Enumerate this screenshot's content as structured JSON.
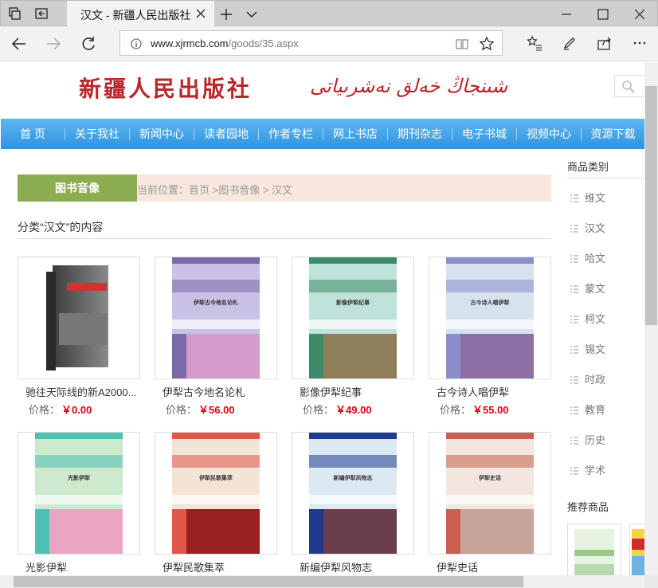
{
  "browser": {
    "tab_title": "汉文 - 新疆人民出版社",
    "url_domain": "www.xjrmcb.com",
    "url_path": "/goods/35.aspx"
  },
  "site": {
    "logo_cn": "新疆人民出版社",
    "logo_ug": "شىنجاڭ خەلق نەشرىياتى"
  },
  "menu": [
    "首 页",
    "关于我社",
    "新闻中心",
    "读者园地",
    "作者专栏",
    "网上书店",
    "期刊杂志",
    "电子书城",
    "视频中心",
    "资源下载"
  ],
  "breadcrumb": {
    "label": "图书音像",
    "text": "当前位置：首页 >图书音像  > 汉文"
  },
  "section_title": "分类“汉文”的内容",
  "books": [
    {
      "name": "驰往天际线的新A2000...",
      "price_label": "价格：",
      "price": "￥0.00",
      "cover_title": "",
      "palette": [
        "#666",
        "#444",
        "#999"
      ]
    },
    {
      "name": "伊犁古今地名论札",
      "price_label": "价格：",
      "price": "￥56.00",
      "cover_title": "伊犁古今地名论札",
      "palette": [
        "#c9c2e6",
        "#7b6aa8",
        "#d69cc9"
      ]
    },
    {
      "name": "影像伊犁纪事",
      "price_label": "价格：",
      "price": "￥49.00",
      "cover_title": "影像伊犁纪事",
      "palette": [
        "#bfe3da",
        "#3f8a6b",
        "#8e7f5a"
      ]
    },
    {
      "name": "古今诗人唱伊犁",
      "price_label": "价格：",
      "price": "￥55.00",
      "cover_title": "古今诗人唱伊犁",
      "palette": [
        "#d6e2ee",
        "#8a8fc9",
        "#8d6fa6"
      ]
    },
    {
      "name": "光影伊犁",
      "price_label": "",
      "price": "",
      "cover_title": "光影伊犁",
      "palette": [
        "#cdeacf",
        "#4cc0b3",
        "#e9a6c2"
      ]
    },
    {
      "name": "伊犁民歌集萃",
      "price_label": "",
      "price": "",
      "cover_title": "伊犁民歌集萃",
      "palette": [
        "#f4e4d8",
        "#e0574a",
        "#9a1f1f"
      ]
    },
    {
      "name": "新编伊犁风物志",
      "price_label": "",
      "price": "",
      "cover_title": "新编伊犁风物志",
      "palette": [
        "#dce9f2",
        "#1f3b8f",
        "#6b3e4e"
      ]
    },
    {
      "name": "伊犁史话",
      "price_label": "",
      "price": "",
      "cover_title": "伊犁史话",
      "palette": [
        "#f3e6de",
        "#c9604f",
        "#c7a59d"
      ]
    }
  ],
  "sidebar": {
    "heading": "商品类别",
    "categories": [
      "维文",
      "汉文",
      "哈文",
      "蒙文",
      "柯文",
      "锡文",
      "时政",
      "教育",
      "历史",
      "学术"
    ],
    "recommended_heading": "推荐商品"
  }
}
